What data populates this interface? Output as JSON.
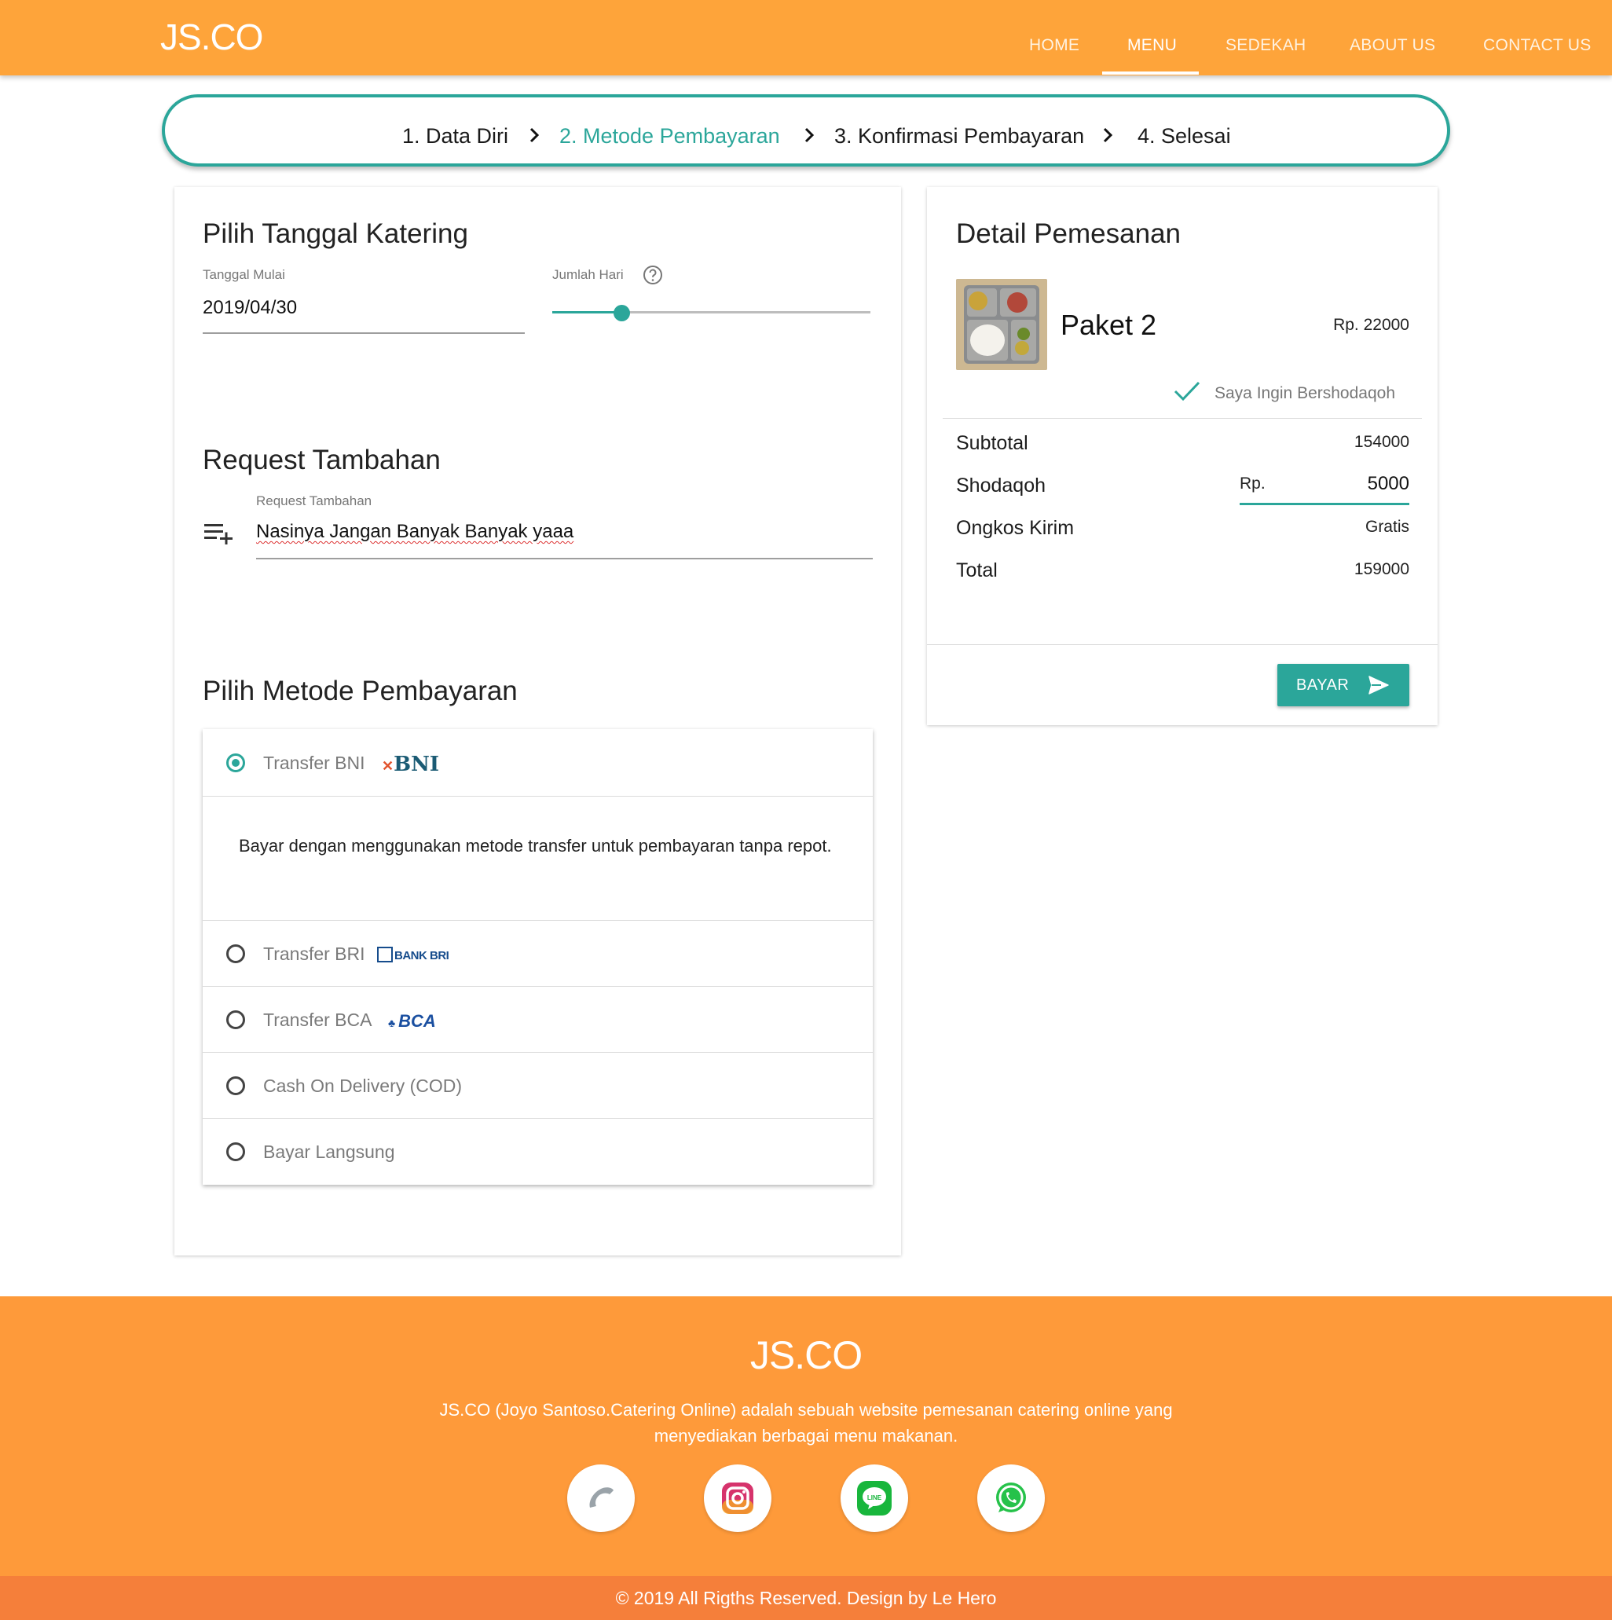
{
  "navbar": {
    "brand": "JS.CO",
    "items": [
      {
        "label": "HOME"
      },
      {
        "label": "MENU"
      },
      {
        "label": "SEDEKAH"
      },
      {
        "label": "ABOUT US"
      },
      {
        "label": "CONTACT US"
      }
    ],
    "active_item": "MENU"
  },
  "stepper": {
    "steps": [
      "1. Data Diri",
      "2. Metode Pembayaran",
      "3. Konfirmasi Pembayaran",
      "4. Selesai"
    ],
    "active_step": "2. Metode Pembayaran"
  },
  "tanggal": {
    "title": "Pilih Tanggal Katering",
    "start_label": "Tanggal Mulai",
    "start_value": "2019/04/30",
    "days_label": "Jumlah Hari"
  },
  "request": {
    "title": "Request Tambahan",
    "field_label": "Request Tambahan",
    "field_value": "Nasinya Jangan Banyak Banyak yaaa"
  },
  "payment": {
    "title": "Pilih Metode Pembayaran",
    "selected": "Transfer BNI",
    "description": "Bayar dengan menggunakan metode transfer untuk pembayaran tanpa repot.",
    "methods": [
      {
        "label": "Transfer BNI",
        "logo": "BNI"
      },
      {
        "label": "Transfer BRI",
        "logo": "BANK BRI"
      },
      {
        "label": "Transfer BCA",
        "logo": "BCA"
      },
      {
        "label": "Cash On Delivery (COD)"
      },
      {
        "label": "Bayar Langsung"
      }
    ]
  },
  "detail": {
    "title": "Detail Pemesanan",
    "product_name": "Paket 2",
    "product_price": "Rp. 22000",
    "sedekah_label": "Saya Ingin Bershodaqoh",
    "subtotal_label": "Subtotal",
    "subtotal_value": "154000",
    "shodaqoh_label": "Shodaqoh",
    "shodaqoh_prefix": "Rp.",
    "shodaqoh_value": "5000",
    "ongkir_label": "Ongkos Kirim",
    "ongkir_value": "Gratis",
    "total_label": "Total",
    "total_value": "159000",
    "pay_button": "BAYAR"
  },
  "footer": {
    "brand": "JS.CO",
    "description": "JS.CO (Joyo Santoso.Catering Online) adalah sebuah website pemesanan catering online yang menyediakan berbagai menu makanan.",
    "copyright": "© 2019 All Rigths Reserved. Design by Le Hero",
    "social_icons": [
      "phone-icon",
      "instagram-icon",
      "line-icon",
      "whatsapp-icon"
    ]
  },
  "colors": {
    "brand_orange": "#fea43a",
    "accent_teal": "#2ba69a",
    "footer_bottom": "#f57f3a"
  }
}
